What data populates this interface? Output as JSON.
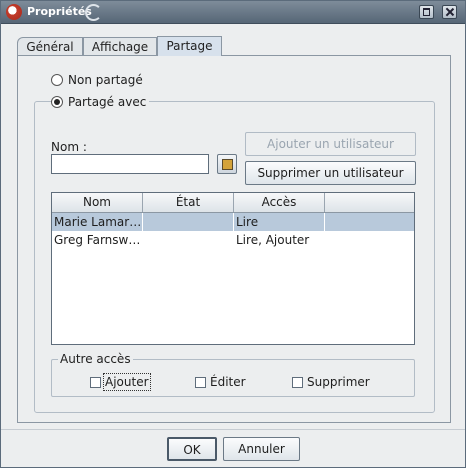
{
  "window": {
    "title": "Propriétés"
  },
  "tabs": [
    {
      "label": "Général"
    },
    {
      "label": "Affichage"
    },
    {
      "label": "Partage"
    }
  ],
  "sharing": {
    "not_shared_label": "Non partagé",
    "shared_with_label": "Partagé avec",
    "selected": "shared_with",
    "name_label": "Nom :",
    "name_value": "",
    "add_user_label": "Ajouter un utilisateur",
    "remove_user_label": "Supprimer un utilisateur"
  },
  "table": {
    "columns": [
      "Nom",
      "État",
      "Accès",
      ""
    ],
    "rows": [
      {
        "name": "Marie Lamar…",
        "state": "",
        "access": "Lire",
        "extra": "",
        "selected": true
      },
      {
        "name": "Greg Farnsw…",
        "state": "",
        "access": "Lire, Ajouter",
        "extra": "",
        "selected": false
      }
    ]
  },
  "other_access": {
    "legend": "Autre accès",
    "options": [
      {
        "label": "Ajouter",
        "checked": false
      },
      {
        "label": "Éditer",
        "checked": false
      },
      {
        "label": "Supprimer",
        "checked": false
      }
    ]
  },
  "buttons": {
    "ok": "OK",
    "cancel": "Annuler"
  }
}
